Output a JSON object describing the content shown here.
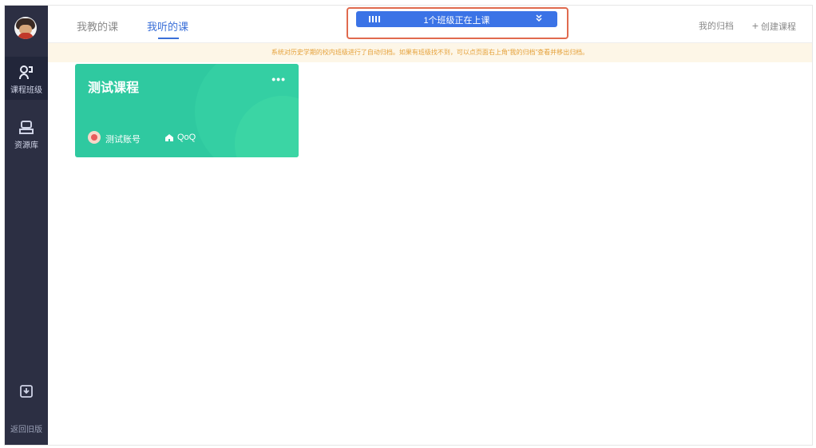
{
  "sidebar": {
    "items": [
      {
        "label": "课程班级",
        "icon": "class-icon"
      },
      {
        "label": "资源库",
        "icon": "library-icon"
      }
    ],
    "download_icon": "download-icon",
    "old_version_label": "返回旧版"
  },
  "header": {
    "tabs": [
      {
        "label": "我教的课"
      },
      {
        "label": "我听的课"
      }
    ],
    "live_banner": "1个班级正在上课",
    "archive_label": "我的归档",
    "create_label": "创建课程"
  },
  "notice": "系统对历史学期的校内班级进行了自动归档。如果有班级找不到，可以点页面右上角“我的归档”查看并移出归档。",
  "card": {
    "title": "测试课程",
    "more": "•••",
    "owner": "测试账号",
    "school": "QoQ"
  },
  "colors": {
    "sidebar": "#2c2f43",
    "accent": "#3a6fd8",
    "card": "#2fc9a0",
    "highlight_box": "#e06a4e"
  }
}
